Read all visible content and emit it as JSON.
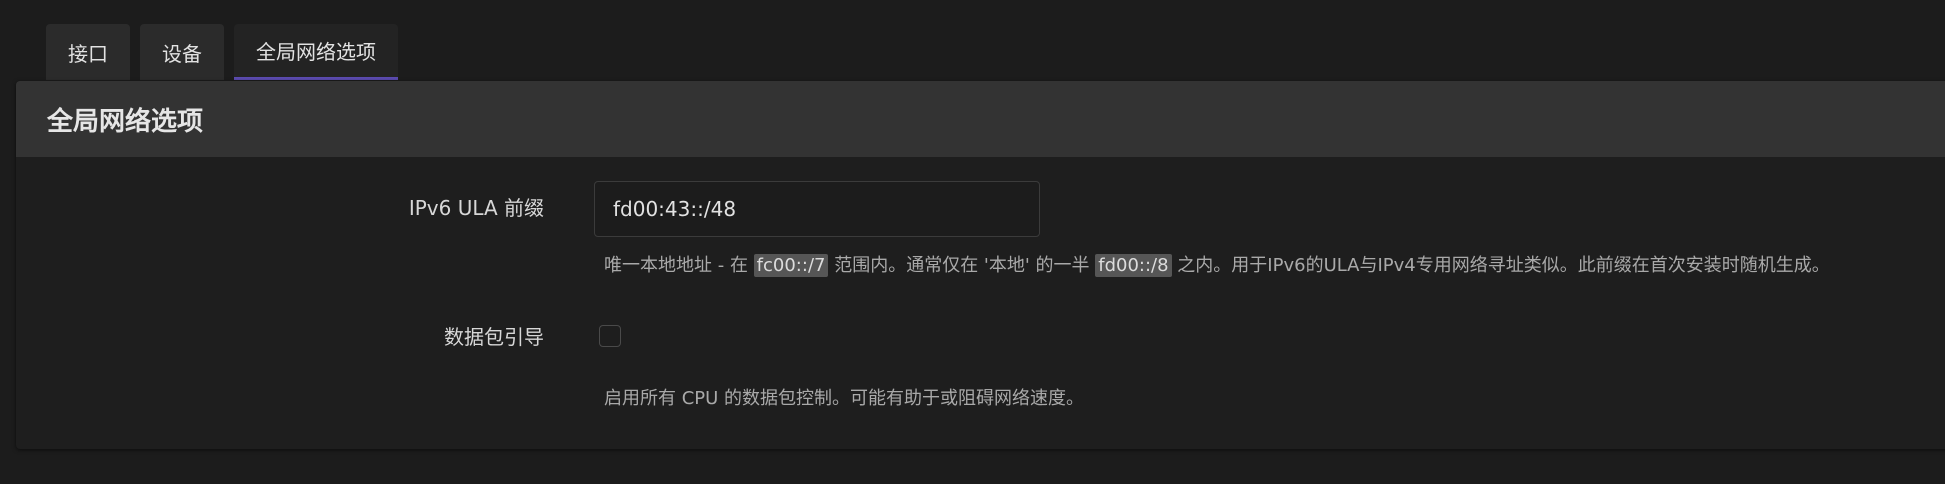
{
  "tabs": [
    {
      "label": "接口"
    },
    {
      "label": "设备"
    },
    {
      "label": "全局网络选项"
    }
  ],
  "panel": {
    "title": "全局网络选项"
  },
  "ula": {
    "label": "IPv6 ULA 前缀",
    "value": "fd00:43::/48",
    "desc_part1": "唯一本地地址 - 在 ",
    "code1": "fc00::/7",
    "desc_part2": " 范围内。通常仅在 '本地' 的一半 ",
    "code2": "fd00::/8",
    "desc_part3": " 之内。用于IPv6的ULA与IPv4专用网络寻址类似。此前缀在首次安装时随机生成。"
  },
  "packet_steering": {
    "label": "数据包引导",
    "checked": false,
    "desc": "启用所有 CPU 的数据包控制。可能有助于或阻碍网络速度。"
  }
}
